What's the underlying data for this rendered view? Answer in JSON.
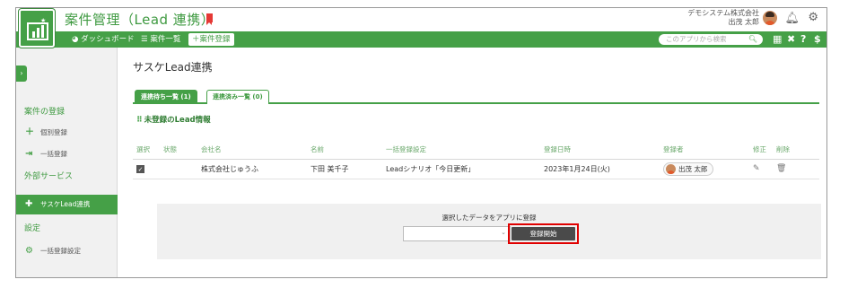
{
  "header": {
    "app_title": "案件管理（Lead 連携）",
    "company": "デモシステム株式会社",
    "user_name": "出茂 太郎"
  },
  "nav": {
    "items": [
      {
        "label": "ダッシュボード",
        "icon": "dashboard-icon"
      },
      {
        "label": "案件一覧",
        "icon": "list-icon"
      },
      {
        "label": "案件登録",
        "icon": "plus-icon"
      }
    ],
    "search_placeholder": "このアプリから検索"
  },
  "sidebar": {
    "toggle": "›",
    "section1": "案件の登録",
    "items1": [
      {
        "label": "個別登録",
        "icon": "plus-icon"
      },
      {
        "label": "一括登録",
        "icon": "bulk-import-icon"
      }
    ],
    "section2": "外部サービス",
    "items2": [
      {
        "label": "サスケLead連携",
        "icon": "puzzle-icon",
        "active": true
      }
    ],
    "section3": "設定",
    "items3": [
      {
        "label": "一括登録設定",
        "icon": "gear-icon"
      }
    ]
  },
  "main": {
    "page_title": "サスケLead連携",
    "tabs": [
      {
        "label": "連携待ち一覧 (1)",
        "active": true
      },
      {
        "label": "連携済み一覧 (0)",
        "active": false
      }
    ],
    "section_title": "未登録のLead情報",
    "table": {
      "headers": [
        "選択",
        "状態",
        "会社名",
        "名前",
        "一括登録設定",
        "登録日時",
        "登録者",
        "修正",
        "削除"
      ],
      "rows": [
        {
          "selected": true,
          "status": "",
          "company": "株式会社じゅうふ",
          "name": "下田 美千子",
          "setting": "Leadシナリオ「今日更新」",
          "date": "2023年1月24日(火)",
          "registrant": "出茂 太郎"
        }
      ]
    },
    "register": {
      "label": "選択したデータをアプリに登録",
      "select_value": "",
      "button": "登録開始"
    }
  },
  "colors": {
    "accent": "#45a047",
    "highlight": "#e00000",
    "button": "#4a4a4a"
  }
}
